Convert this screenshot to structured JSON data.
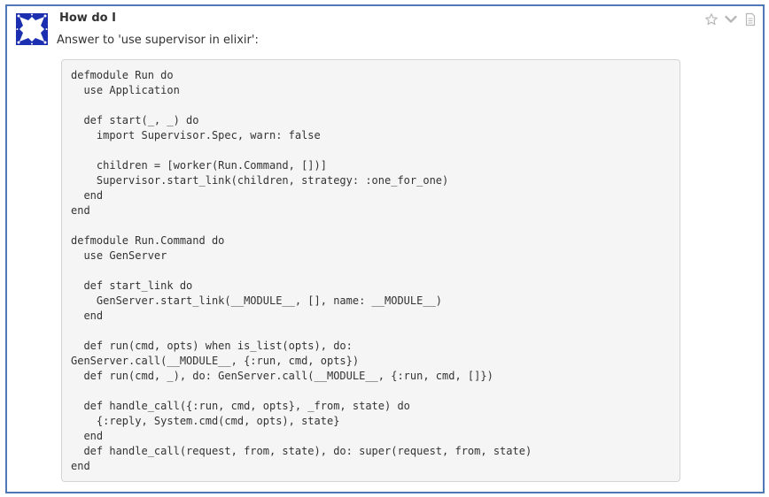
{
  "message": {
    "sender": "How do I",
    "intro": "Answer to 'use supervisor in elixir':",
    "code": "defmodule Run do\n  use Application\n\n  def start(_, _) do\n    import Supervisor.Spec, warn: false\n\n    children = [worker(Run.Command, [])]\n    Supervisor.start_link(children, strategy: :one_for_one)\n  end\nend\n\ndefmodule Run.Command do\n  use GenServer\n\n  def start_link do\n    GenServer.start_link(__MODULE__, [], name: __MODULE__)\n  end\n\n  def run(cmd, opts) when is_list(opts), do:\nGenServer.call(__MODULE__, {:run, cmd, opts})\n  def run(cmd, _), do: GenServer.call(__MODULE__, {:run, cmd, []})\n\n  def handle_call({:run, cmd, opts}, _from, state) do\n    {:reply, System.cmd(cmd, opts), state}\n  end\n  def handle_call(request, from, state), do: super(request, from, state)\nend"
  },
  "icons": {
    "avatar": "bot-avatar-icon",
    "star": "star-icon",
    "chevron": "chevron-down-icon",
    "document": "document-icon"
  },
  "colors": {
    "frame_border": "#4e79b6",
    "avatar_blue": "#1c2fb0",
    "code_background": "#f5f5f5",
    "code_border": "#d4d4d4",
    "icon_gray": "#b8b8b8"
  }
}
